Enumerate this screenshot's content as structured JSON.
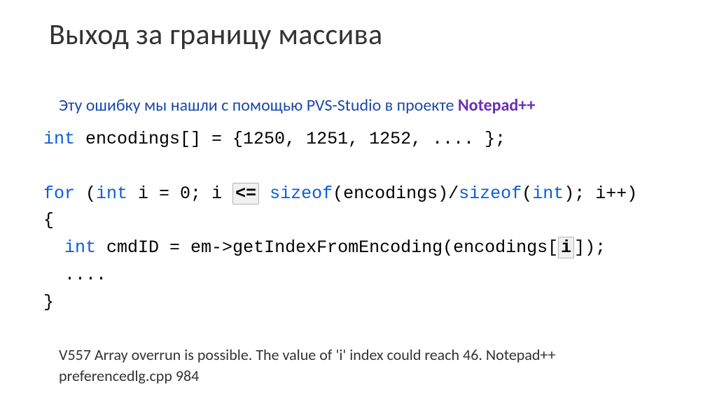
{
  "title": "Выход за границу массива",
  "subtitle_prefix": "Эту ошибку мы нашли с помощью PVS-Studio в проекте ",
  "project_name": "Notepad++",
  "code": {
    "l1_kw": "int",
    "l1_rest": " encodings[] = {1250, 1251, 1252, .... };",
    "l2_for": "for",
    "l2_a": " (",
    "l2_int": "int",
    "l2_b": " i = 0; i ",
    "l2_op": "<=",
    "l2_c": " ",
    "l2_sz1": "sizeof",
    "l2_d": "(encodings)/",
    "l2_sz2": "sizeof",
    "l2_e": "(",
    "l2_int2": "int",
    "l2_f": "); i++)",
    "l3": "{",
    "l4_a": "  ",
    "l4_int": "int",
    "l4_b": " cmdID = em->getIndexFromEncoding(encodings[",
    "l4_i": "i",
    "l4_c": "]);",
    "l5": "  ....",
    "l6": "}"
  },
  "footnote": "V557 Array overrun is possible. The value of 'i' index could reach 46.  Notepad++ preferencedlg.cpp  984"
}
